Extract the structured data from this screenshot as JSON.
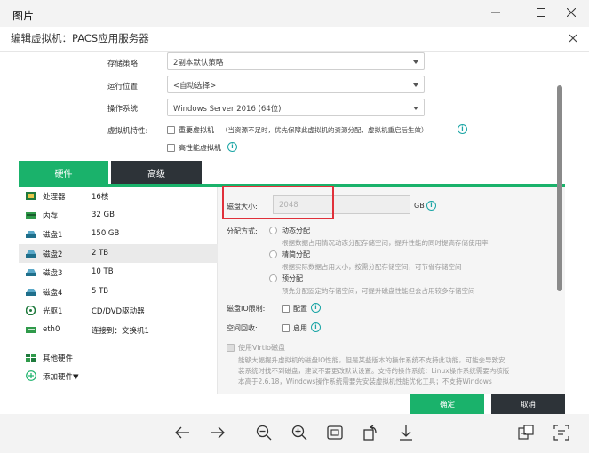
{
  "window": {
    "title": "图片"
  },
  "dialog": {
    "title": "编辑虚拟机：PACS应用服务器"
  },
  "form": {
    "storage_policy": {
      "label": "存储策略:",
      "value": "2副本默认策略"
    },
    "run_location": {
      "label": "运行位置:",
      "value": "<自动选择>"
    },
    "os": {
      "label": "操作系统:",
      "value": "Windows Server 2016 (64位)"
    },
    "vm_features": {
      "label": "虚拟机特性:",
      "reboot_vm": "重要虚拟机",
      "reboot_desc": "（当资源不足时，优先保障此虚拟机的资源分配，虚拟机重启后生效）",
      "high_perf_vm": "高性能虚拟机"
    }
  },
  "tabs": [
    {
      "label": "硬件"
    },
    {
      "label": "高级"
    }
  ],
  "hardware": [
    {
      "name": "处理器",
      "value": "16核"
    },
    {
      "name": "内存",
      "value": "32 GB"
    },
    {
      "name": "磁盘1",
      "value": "150 GB"
    },
    {
      "name": "磁盘2",
      "value": "2 TB"
    },
    {
      "name": "磁盘3",
      "value": "10 TB"
    },
    {
      "name": "磁盘4",
      "value": "5 TB"
    },
    {
      "name": "光驱1",
      "value": "CD/DVD驱动器"
    },
    {
      "name": "eth0",
      "value": "连接到：交换机1"
    },
    {
      "name": "其他硬件",
      "value": ""
    },
    {
      "name": "添加硬件▼",
      "value": ""
    }
  ],
  "disk": {
    "size_label": "磁盘大小:",
    "size_value": "2048",
    "size_unit": "GB",
    "alloc_label": "分配方式:",
    "alloc_options": [
      {
        "label": "动态分配",
        "desc": "根据数据占用情况动态分配存储空间，提升性能的同时提高存储使用率"
      },
      {
        "label": "精简分配",
        "desc": "根据实际数据占用大小，按需分配存储空间，可节省存储空间"
      },
      {
        "label": "预分配",
        "desc": "预先分配固定的存储空间，可提升磁盘性能但会占用较多存储空间"
      }
    ],
    "io_limit_label": "磁盘IO限制:",
    "io_limit_option": "配置",
    "reclaim_label": "空间回收:",
    "reclaim_option": "启用",
    "virtio_label": "使用Virtio磁盘",
    "virtio_desc_1": "能够大幅提升虚拟机的磁盘IO性能，但是某些版本的操作系统不支持此功能，可能会导致安",
    "virtio_desc_2": "装系统时找不到磁盘，建议不要更改默认设置。支持的操作系统：Linux操作系统需要内核版",
    "virtio_desc_3": "本高于2.6.18，Windows操作系统需要先安装虚拟机性能优化工具；不支持Windows"
  },
  "footer": {
    "ok": "确定",
    "cancel": "取消"
  },
  "colors": {
    "accent": "#1ab26b",
    "dark": "#2d3338",
    "highlight": "#e0303a"
  }
}
